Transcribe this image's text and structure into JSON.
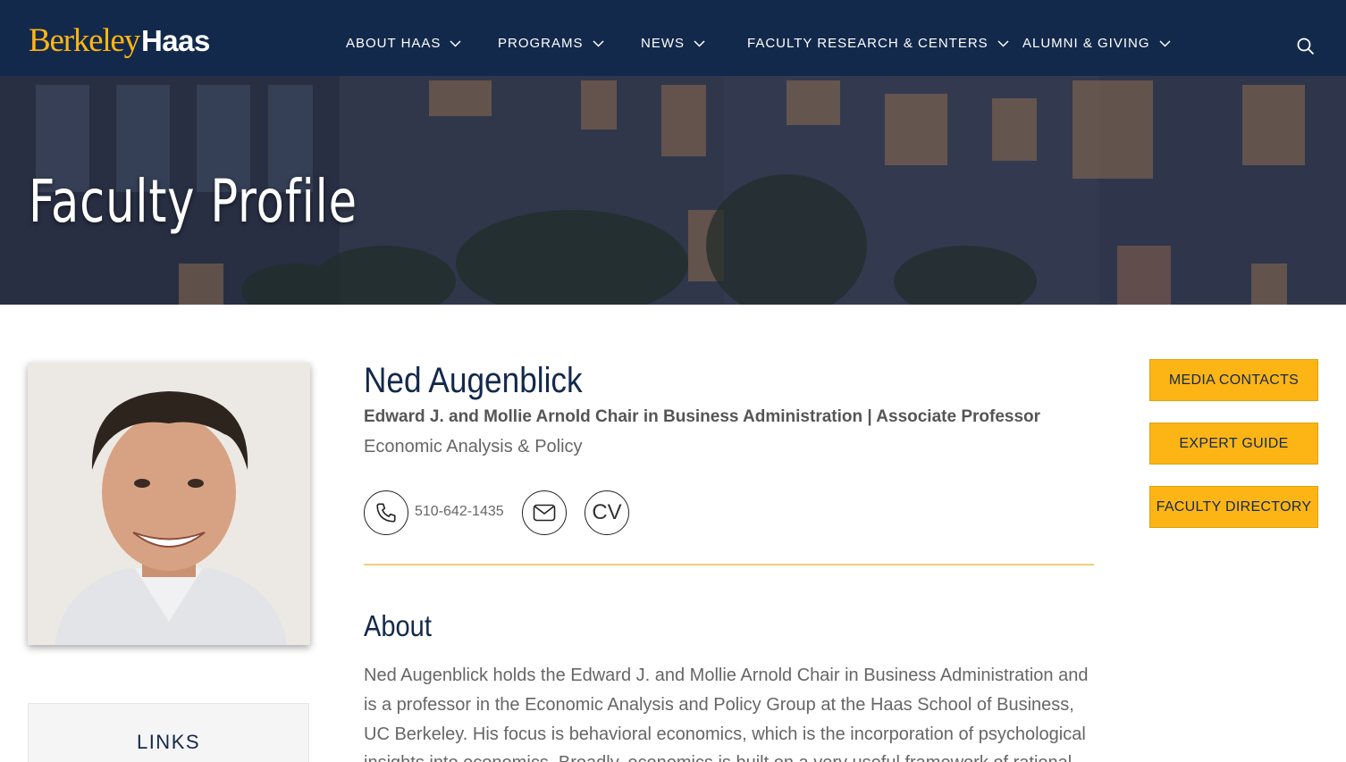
{
  "header": {
    "logo_berkeley": "Berkeley",
    "logo_haas": "Haas",
    "nav": [
      {
        "label": "ABOUT HAAS"
      },
      {
        "label": "PROGRAMS"
      },
      {
        "label": "NEWS"
      },
      {
        "label": "FACULTY RESEARCH & CENTERS"
      },
      {
        "label": "ALUMNI & GIVING"
      }
    ],
    "search_icon": "search-icon"
  },
  "hero": {
    "title": "Faculty Profile"
  },
  "profile": {
    "name": "Ned Augenblick",
    "title": "Edward J. and Mollie Arnold Chair in Business Administration | Associate Professor",
    "department": "Economic Analysis & Policy",
    "phone": "510-642-1435",
    "cv_label": "CV"
  },
  "about": {
    "heading": "About",
    "text": "Ned Augenblick holds the Edward J. and Mollie Arnold Chair in Business Administration and is a professor in the Economic Analysis and Policy Group at the Haas School of Business, UC Berkeley. His focus is behavioral economics, which is the incorporation of psychological insights into economics. Broadly, economics is built on a very useful framework of rational"
  },
  "sidebar": {
    "buttons": [
      {
        "label": "MEDIA CONTACTS"
      },
      {
        "label": "EXPERT GUIDE"
      },
      {
        "label": "FACULTY DIRECTORY"
      }
    ],
    "links_heading": "LINKS"
  },
  "colors": {
    "navy": "#13294b",
    "gold": "#fdb515",
    "divider": "#ecd07a"
  }
}
